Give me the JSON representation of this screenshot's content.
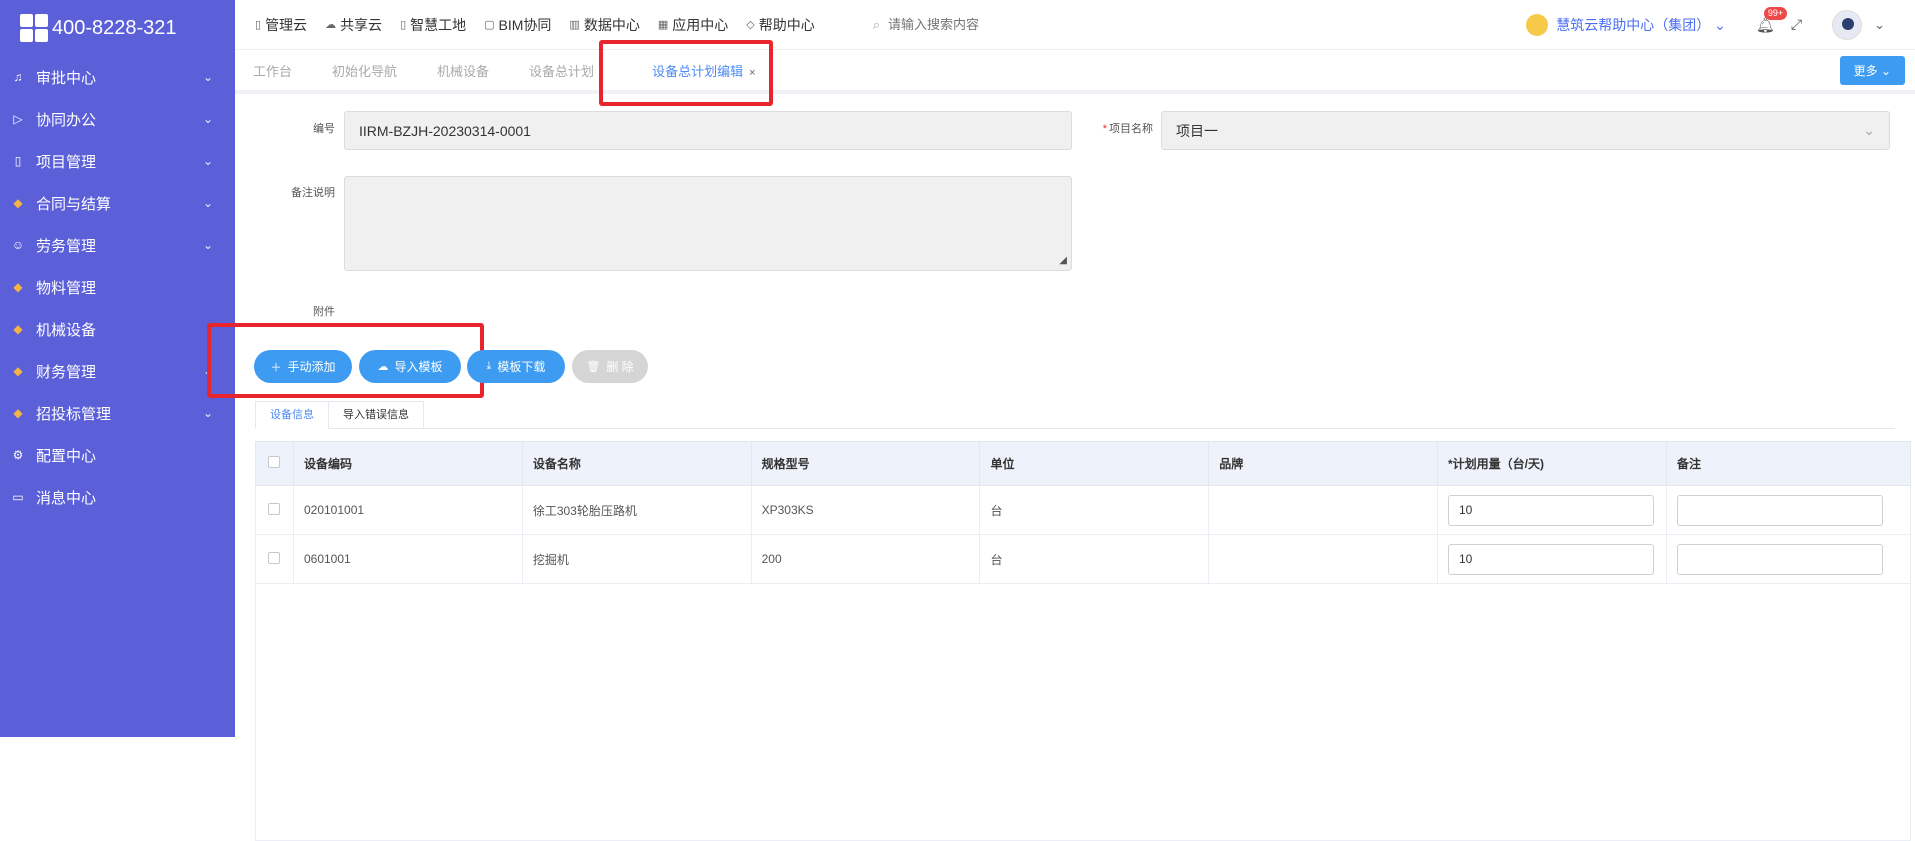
{
  "brand": {
    "phone": "400-8228-321"
  },
  "sidebar": {
    "items": [
      {
        "label": "审批中心",
        "icon": "bell-icon",
        "glyph": "♫",
        "has_arrow": true
      },
      {
        "label": "协同办公",
        "icon": "send-icon",
        "glyph": "▷",
        "has_arrow": true
      },
      {
        "label": "项目管理",
        "icon": "book-icon",
        "glyph": "▯",
        "has_arrow": true
      },
      {
        "label": "合同与结算",
        "icon": "gem-icon",
        "glyph": "◆",
        "has_arrow": true
      },
      {
        "label": "劳务管理",
        "icon": "user-icon",
        "glyph": "☺",
        "has_arrow": true
      },
      {
        "label": "物料管理",
        "icon": "gem-icon",
        "glyph": "◆",
        "has_arrow": false
      },
      {
        "label": "机械设备",
        "icon": "gem-icon",
        "glyph": "◆",
        "has_arrow": false
      },
      {
        "label": "财务管理",
        "icon": "gem-icon",
        "glyph": "◆",
        "has_arrow": true
      },
      {
        "label": "招投标管理",
        "icon": "gem-icon",
        "glyph": "◆",
        "has_arrow": true
      },
      {
        "label": "配置中心",
        "icon": "gear-icon",
        "glyph": "⚙",
        "has_arrow": false
      },
      {
        "label": "消息中心",
        "icon": "chat-icon",
        "glyph": "▭",
        "has_arrow": false
      }
    ]
  },
  "topmenu": [
    {
      "label": "管理云",
      "glyph": "▯"
    },
    {
      "label": "共享云",
      "glyph": "☁"
    },
    {
      "label": "智慧工地",
      "glyph": "▯"
    },
    {
      "label": "BIM协同",
      "glyph": "▢"
    },
    {
      "label": "数据中心",
      "glyph": "▥"
    },
    {
      "label": "应用中心",
      "glyph": "▦"
    },
    {
      "label": "帮助中心",
      "glyph": "◇"
    }
  ],
  "search": {
    "placeholder": "请输入搜索内容"
  },
  "org": {
    "name": "慧筑云帮助中心（集团）"
  },
  "notifications": {
    "badge": "99+"
  },
  "tabs": [
    {
      "label": "工作台",
      "active": false
    },
    {
      "label": "初始化导航",
      "active": false
    },
    {
      "label": "机械设备",
      "active": false
    },
    {
      "label": "设备总计划",
      "active": false
    },
    {
      "label": "设备总计划编辑",
      "active": true
    }
  ],
  "more_button": "更多",
  "form": {
    "code_label": "编号",
    "code_value": "IIRM-BZJH-20230314-0001",
    "project_label": "项目名称",
    "project_value": "项目一",
    "remark_label": "备注说明",
    "remark_value": "",
    "attachment_label": "附件"
  },
  "actions": {
    "manual_add": "手动添加",
    "import_template": "导入模板",
    "download_template": "模板下载",
    "delete": "删 除"
  },
  "subtabs": {
    "info": "设备信息",
    "errors": "导入错误信息"
  },
  "table": {
    "headers": [
      "设备编码",
      "设备名称",
      "规格型号",
      "单位",
      "品牌",
      "*计划用量（台/天)",
      "备注"
    ],
    "rows": [
      {
        "code": "020101001",
        "name": "徐工303轮胎压路机",
        "model": "XP303KS",
        "unit": "台",
        "brand": "",
        "qty": "10",
        "remark": ""
      },
      {
        "code": "0601001",
        "name": "挖掘机",
        "model": "200",
        "unit": "台",
        "brand": "",
        "qty": "10",
        "remark": ""
      }
    ]
  }
}
